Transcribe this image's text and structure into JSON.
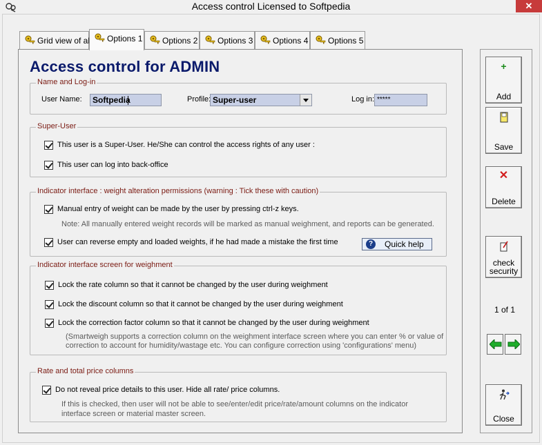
{
  "window": {
    "title": "Access control  Licensed to Softpedia",
    "close_glyph": "✕"
  },
  "tabs": [
    {
      "label": "Grid view of all",
      "icon": "key-person-icon"
    },
    {
      "label": "Options 1",
      "icon": "key-person-icon",
      "active": true
    },
    {
      "label": "Options 2",
      "icon": "key-person-icon"
    },
    {
      "label": "Options 3",
      "icon": "key-person-icon"
    },
    {
      "label": "Options 4",
      "icon": "key-person-icon"
    },
    {
      "label": "Options 5",
      "icon": "key-person-icon"
    }
  ],
  "page_title": "Access control for ADMIN",
  "login_group": {
    "legend": "Name and Log-in",
    "user_name_label": "User Name:",
    "user_name_value": "Softpedia",
    "profile_label": "Profile:",
    "profile_value": "Super-user",
    "login_label": "Log in:",
    "login_value": "*****"
  },
  "super_user_group": {
    "legend": "Super-User",
    "items": [
      {
        "label": "This user is a Super-User. He/She can control the access rights of any user :",
        "checked": true
      },
      {
        "label": "This user can log into back-office",
        "checked": true
      }
    ]
  },
  "indicator_group": {
    "legend": "Indicator interface : weight alteration permissions (warning : Tick these with caution)",
    "manual_entry": {
      "label": "Manual entry of weight can be made by the user by pressing ctrl-z keys.",
      "checked": true
    },
    "note": "Note:  All manually entered weight records will be marked as manual weighment, and  reports can be generated.",
    "reverse": {
      "label": "User can reverse empty and loaded weights,  if he had made a mistake the first time",
      "checked": true
    },
    "quick_help_label": "Quick help"
  },
  "screen_group": {
    "legend": "Indicator interface screen for weighment",
    "items": [
      {
        "label": "Lock the rate column so that it cannot be changed by the user during weighment",
        "checked": true
      },
      {
        "label": "Lock the discount column so that it cannot be changed by the user during weighment",
        "checked": true
      },
      {
        "label": "Lock the correction factor column so that it cannot be changed by the user during weighment",
        "checked": true
      }
    ],
    "note_line1": "(Smartweigh supports a correction column on the weighment interface screen where you can enter % or value of",
    "note_line2": "correction to account for humidity/wastage etc. You can configure correction using 'configurations' menu)"
  },
  "price_group": {
    "legend": "Rate and total price columns",
    "item": {
      "label": "Do not reveal price details to this user. Hide all rate/ price columns.",
      "checked": true
    },
    "note_line1": "If this is checked, then user will not be able to see/enter/edit  price/rate/amount columns on the indicator",
    "note_line2": "interface screen or material master screen."
  },
  "side_panel": {
    "add_label": "Add",
    "save_label": "Save",
    "delete_label": "Delete",
    "check_security_line1": "check",
    "check_security_line2": "security",
    "pager": "1 of 1",
    "close_label": "Close"
  },
  "colors": {
    "title_blue": "#0a1a6b",
    "legend_red": "#7a1a12",
    "field_bg": "#c8d0e6",
    "arrow_green": "#1fae2b",
    "delete_red": "#d21c1c"
  }
}
